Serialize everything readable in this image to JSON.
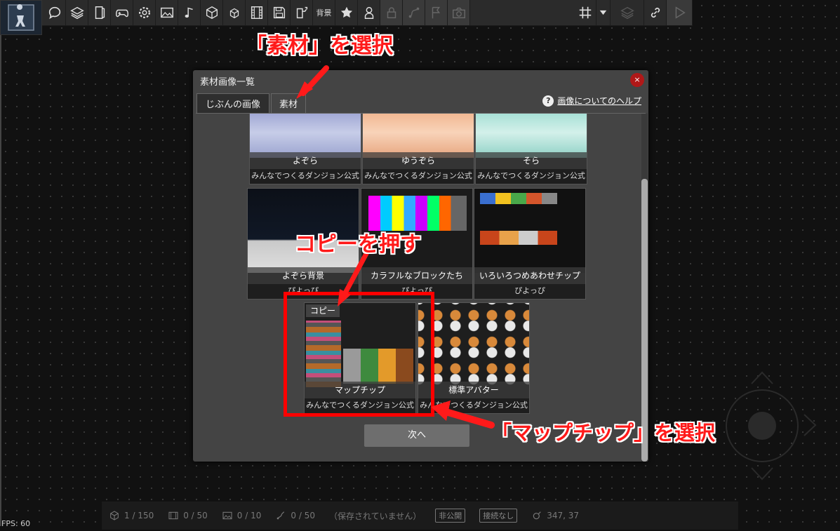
{
  "toolbar": {
    "background_label": "背景",
    "icons": [
      "logo-character-icon",
      "speech-bubble-icon",
      "layers-stack-icon",
      "door-icon",
      "gamepad-icon",
      "gear-icon",
      "image-icon",
      "music-note-icon",
      "cube-icon",
      "small-cube-icon",
      "film-icon",
      "save-disk-icon",
      "export-icon",
      "star-icon",
      "person-icon",
      "lock-icon",
      "route-icon",
      "flag-icon",
      "camera-icon",
      "grid-icon",
      "dropdown-arrow-icon",
      "layers-icon",
      "link-icon",
      "play-icon"
    ]
  },
  "dialog": {
    "title": "素材画像一覧",
    "close_label": "×",
    "tabs": [
      {
        "label": "じぶんの画像",
        "active": false
      },
      {
        "label": "素材",
        "active": true
      }
    ],
    "help_icon": "?",
    "help_link": "画像についてのヘルプ",
    "cards": [
      {
        "name": "よぞら",
        "author": "みんなでつくるダンジョン公式",
        "color": "#8f9ac8"
      },
      {
        "name": "ゆうぞら",
        "author": "みんなでつくるダンジョン公式",
        "color": "#e7a57e"
      },
      {
        "name": "そら",
        "author": "みんなでつくるダンジョン公式",
        "color": "#8fd1c6"
      },
      {
        "name": "よぞら背景",
        "author": "ぴよっぴ",
        "color": "#0f1420"
      },
      {
        "name": "カラフルなブロックたち",
        "author": "ぴよっぴ",
        "color": "#1b1b1b"
      },
      {
        "name": "いろいろつめあわせチップ",
        "author": "ぴよっぴ",
        "color": "#111111"
      },
      {
        "name": "マップチップ",
        "author": "みんなでつくるダンジョン公式",
        "color": "#1e1e1e"
      },
      {
        "name": "標準アバター",
        "author": "みんなでつくるダンジョン公式",
        "color": "#1e1e1e"
      }
    ],
    "copy_badge": "コピー",
    "next_button": "次へ"
  },
  "status_bar": {
    "objects": "1 / 150",
    "scenes": "0 / 50",
    "images": "0 / 10",
    "sounds": "0 / 50",
    "save_status": "（保存されていません）",
    "visibility": "非公開",
    "connection": "接続なし",
    "coords": "347, 37"
  },
  "fps": "FPS: 60",
  "annotations": {
    "select_material": "「素材」を選択",
    "press_copy": "コピーを押す",
    "select_mapchip": "「マップチップ」を選択"
  },
  "colors": {
    "accent_red": "#ff1a1a",
    "close_red": "#b01818",
    "dialog_bg": "#444444"
  }
}
